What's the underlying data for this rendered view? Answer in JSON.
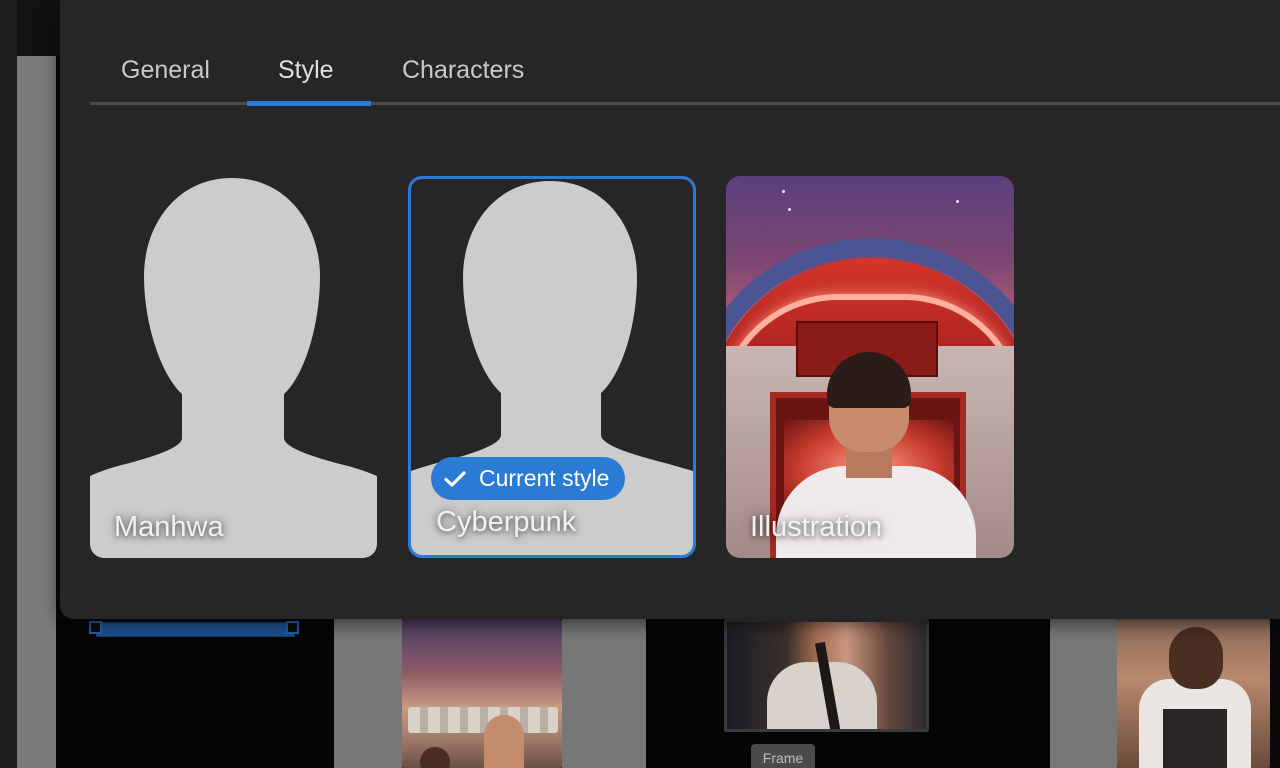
{
  "tabs": [
    {
      "label": "General"
    },
    {
      "label": "Style"
    },
    {
      "label": "Characters"
    }
  ],
  "active_tab": "Style",
  "styles": [
    {
      "label": "Manhwa"
    },
    {
      "label": "Cyberpunk",
      "selected": true
    },
    {
      "label": "Illustration"
    }
  ],
  "current_style_badge": "Current style",
  "background": {
    "frame_tag": "Frame"
  },
  "icons": {
    "check": "check-icon",
    "silhouette": "person-silhouette-icon"
  },
  "colors": {
    "accent": "#2a7bd4",
    "modal_bg": "#262626",
    "silhouette": "#cccccc"
  }
}
